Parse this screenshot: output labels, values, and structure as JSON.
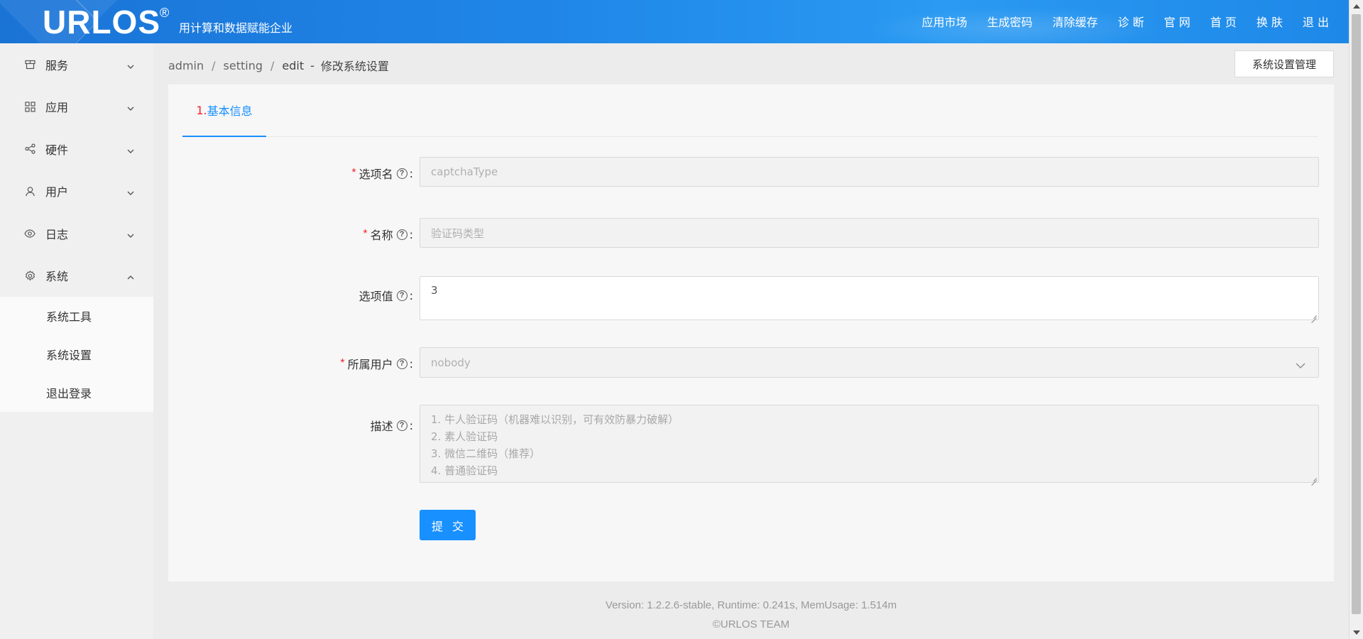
{
  "header": {
    "logo": "URLOS",
    "logo_mark": "®",
    "slogan": "用计算和数据赋能企业",
    "nav": [
      "应用市场",
      "生成密码",
      "清除缓存",
      "诊 断",
      "官 网",
      "首 页",
      "换 肤",
      "退 出"
    ]
  },
  "sidebar": {
    "items": [
      {
        "label": "服务",
        "icon": "store-icon",
        "expanded": false
      },
      {
        "label": "应用",
        "icon": "grid-icon",
        "expanded": false
      },
      {
        "label": "硬件",
        "icon": "share-icon",
        "expanded": false
      },
      {
        "label": "用户",
        "icon": "user-icon",
        "expanded": false
      },
      {
        "label": "日志",
        "icon": "eye-icon",
        "expanded": false
      },
      {
        "label": "系统",
        "icon": "gear-icon",
        "expanded": true
      }
    ],
    "submenu": [
      "系统工具",
      "系统设置",
      "退出登录"
    ]
  },
  "breadcrumb": {
    "parts": [
      "admin",
      "setting",
      "edit"
    ],
    "dash": "-",
    "current": "修改系统设置"
  },
  "top_button": "系统设置管理",
  "tab": {
    "num": "1.",
    "text": "基本信息"
  },
  "form": {
    "option_name": {
      "label": "选项名",
      "value": "captchaType",
      "required": true
    },
    "name": {
      "label": "名称",
      "value": "验证码类型",
      "required": true
    },
    "option_value": {
      "label": "选项值",
      "value": "3",
      "required": false
    },
    "owner": {
      "label": "所属用户",
      "value": "nobody",
      "required": true
    },
    "description": {
      "label": "描述",
      "lines": [
        "1. 牛人验证码（机器难以识别，可有效防暴力破解）",
        "2. 素人验证码",
        "3. 微信二维码（推荐）",
        "4. 普通验证码"
      ]
    },
    "submit": "提 交",
    "help_glyph": "?",
    "colon": ":",
    "required_mark": "*"
  },
  "footer": {
    "line1": "Version: 1.2.2.6-stable,    Runtime: 0.241s,    MemUsage: 1.514m",
    "line2": "©URLOS TEAM"
  },
  "colors": {
    "primary": "#1890ff",
    "header": "#1f86e8",
    "required": "#f5222d"
  }
}
